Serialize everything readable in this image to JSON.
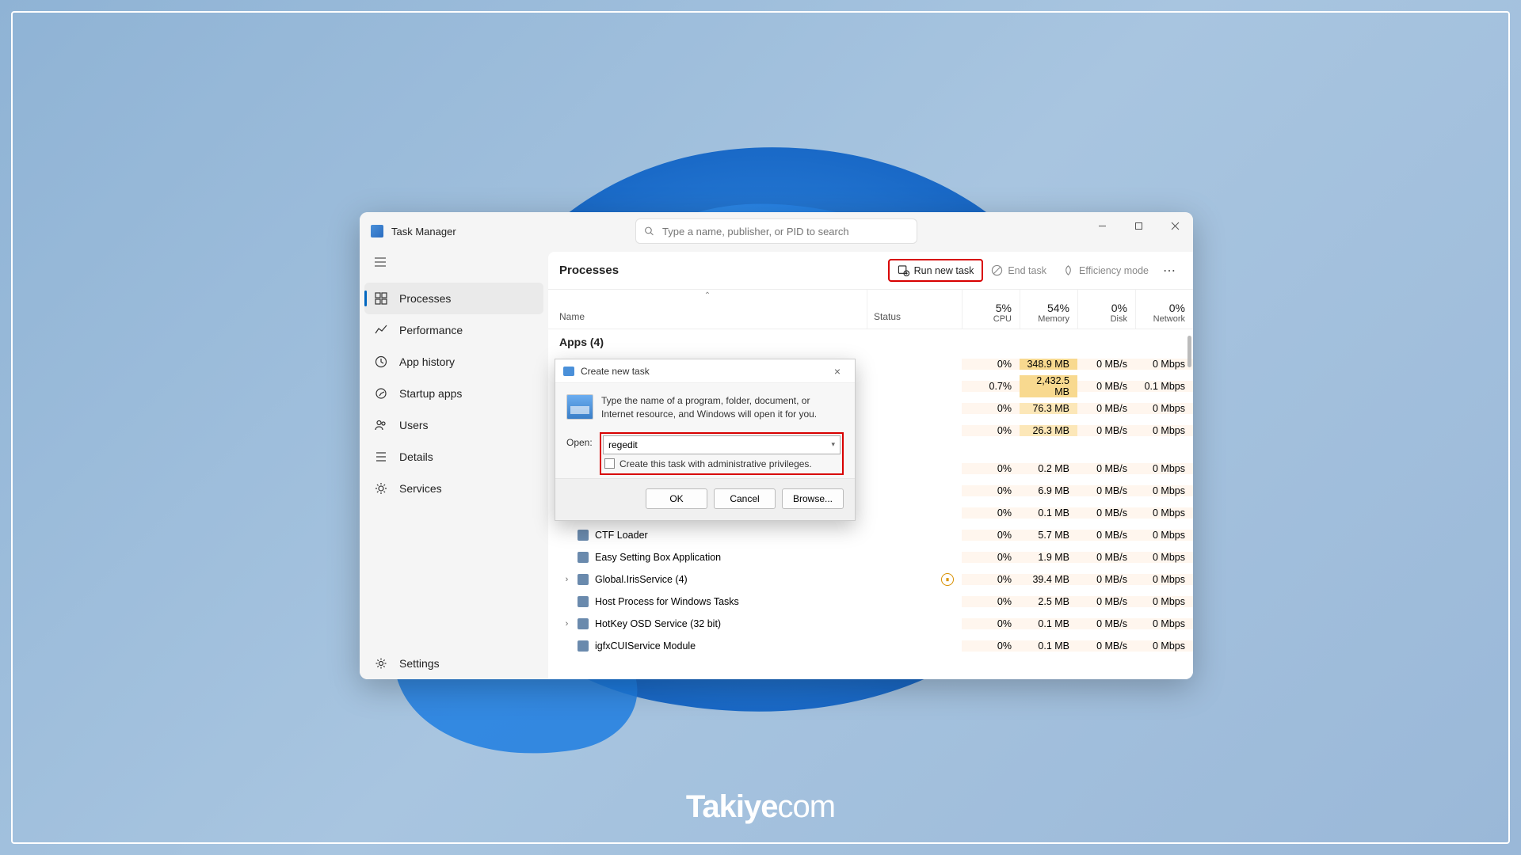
{
  "app": {
    "title": "Task Manager",
    "search_placeholder": "Type a name, publisher, or PID to search"
  },
  "sidebar": {
    "items": [
      {
        "label": "Processes"
      },
      {
        "label": "Performance"
      },
      {
        "label": "App history"
      },
      {
        "label": "Startup apps"
      },
      {
        "label": "Users"
      },
      {
        "label": "Details"
      },
      {
        "label": "Services"
      }
    ],
    "settings": "Settings"
  },
  "toolbar": {
    "heading": "Processes",
    "run_new_task": "Run new task",
    "end_task": "End task",
    "efficiency": "Efficiency mode"
  },
  "columns": {
    "name": "Name",
    "status": "Status",
    "cpu_pct": "5%",
    "cpu": "CPU",
    "mem_pct": "54%",
    "mem": "Memory",
    "disk_pct": "0%",
    "disk": "Disk",
    "net_pct": "0%",
    "net": "Network"
  },
  "groups": {
    "apps": "Apps (4)"
  },
  "rows": [
    {
      "name": "",
      "cpu": "0%",
      "mem": "348.9 MB",
      "memClass": "mem-high",
      "disk": "0 MB/s",
      "net": "0 Mbps"
    },
    {
      "name": "",
      "cpu": "0.7%",
      "mem": "2,432.5 MB",
      "memClass": "mem-high",
      "disk": "0 MB/s",
      "net": "0.1 Mbps"
    },
    {
      "name": "",
      "cpu": "0%",
      "mem": "76.3 MB",
      "memClass": "mem-mid",
      "disk": "0 MB/s",
      "net": "0 Mbps"
    },
    {
      "name": "",
      "cpu": "0%",
      "mem": "26.3 MB",
      "memClass": "mem-mid",
      "disk": "0 MB/s",
      "net": "0 Mbps"
    },
    {
      "name": "",
      "cpu": "0%",
      "mem": "0.2 MB",
      "disk": "0 MB/s",
      "net": "0 Mbps"
    },
    {
      "name": "",
      "cpu": "0%",
      "mem": "6.9 MB",
      "disk": "0 MB/s",
      "net": "0 Mbps"
    },
    {
      "name": "",
      "cpu": "0%",
      "mem": "0.1 MB",
      "disk": "0 MB/s",
      "net": "0 Mbps"
    },
    {
      "name": "CTF Loader",
      "cpu": "0%",
      "mem": "5.7 MB",
      "disk": "0 MB/s",
      "net": "0 Mbps"
    },
    {
      "name": "Easy Setting Box Application",
      "cpu": "0%",
      "mem": "1.9 MB",
      "disk": "0 MB/s",
      "net": "0 Mbps"
    },
    {
      "name": "Global.IrisService (4)",
      "expand": true,
      "paused": true,
      "cpu": "0%",
      "mem": "39.4 MB",
      "disk": "0 MB/s",
      "net": "0 Mbps"
    },
    {
      "name": "Host Process for Windows Tasks",
      "cpu": "0%",
      "mem": "2.5 MB",
      "disk": "0 MB/s",
      "net": "0 Mbps"
    },
    {
      "name": "HotKey OSD Service (32 bit)",
      "expand": true,
      "cpu": "0%",
      "mem": "0.1 MB",
      "disk": "0 MB/s",
      "net": "0 Mbps"
    },
    {
      "name": "igfxCUIService Module",
      "cpu": "0%",
      "mem": "0.1 MB",
      "disk": "0 MB/s",
      "net": "0 Mbps"
    }
  ],
  "dialog": {
    "title": "Create new task",
    "message": "Type the name of a program, folder, document, or Internet resource, and Windows will open it for you.",
    "open_label": "Open:",
    "value": "regedit",
    "admin_check": "Create this task with administrative privileges.",
    "ok": "OK",
    "cancel": "Cancel",
    "browse": "Browse..."
  },
  "watermark": {
    "a": "Takiye",
    "b": "com"
  }
}
